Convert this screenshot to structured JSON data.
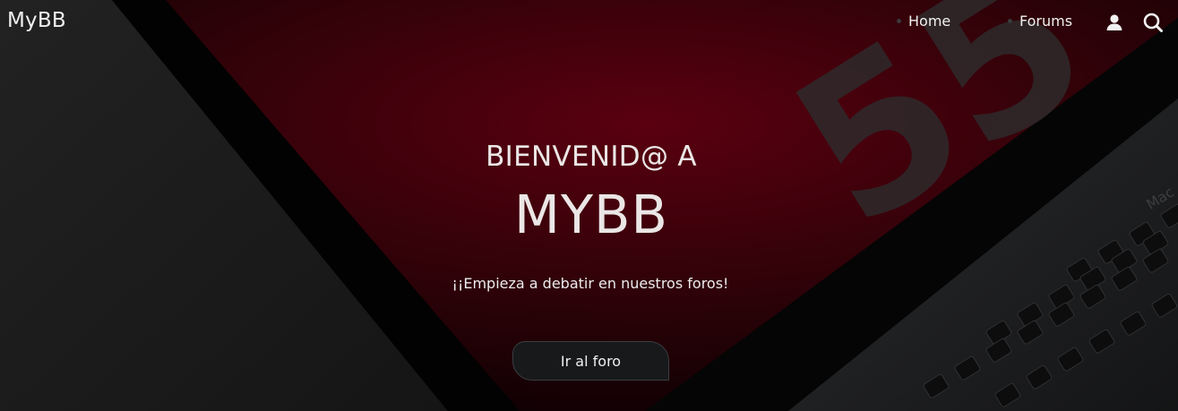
{
  "nav": {
    "brand": "MyBB",
    "links": [
      {
        "label": "Home"
      },
      {
        "label": "Forums"
      }
    ],
    "icons": [
      "user-icon",
      "search-icon"
    ]
  },
  "hero": {
    "welcome": "BIENVENID@ A",
    "site_name": "MYBB",
    "tagline": "¡¡Empieza a debatir en nuestros foros!",
    "cta_label": "Ir al foro",
    "background_text": "55",
    "keyboard_label": "Mac"
  },
  "colors": {
    "background": "#140004",
    "accent_red": "#5a0010",
    "button": "#17191b",
    "text": "#ececec"
  }
}
